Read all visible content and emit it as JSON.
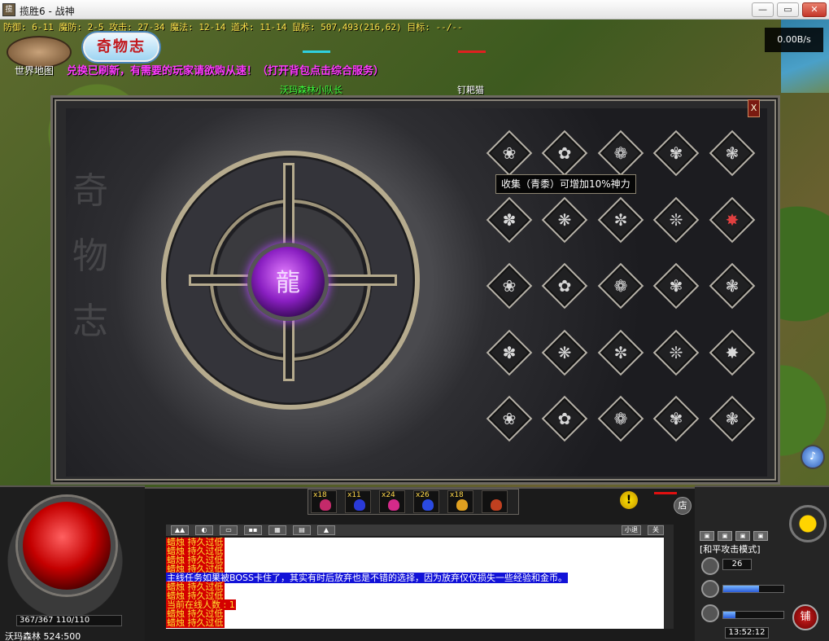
{
  "window": {
    "title": "揽胜6 - 战神",
    "app_icon": "揽"
  },
  "hud_top": {
    "stats_line": "防御: 6-11 魔防: 2-5 攻击: 27-34 魔法: 12-14 道术: 11-14 鼠标: 507,493(216,62) 目标: --/--",
    "net_speed": "0.00B/s",
    "world_map_label": "世界地图",
    "logo_text": "奇物志",
    "broadcast": "兑换已刷新，有需要的玩家请欲购从速！（打开背包点击综合服务）",
    "npc1": "沃玛森林小队长",
    "npc2": "钉耙猫"
  },
  "panel": {
    "side_text": [
      "奇",
      "物",
      "志"
    ],
    "core_emblem": "龍",
    "tooltip": "收集（青黍）可增加10%神力",
    "close_label": "X",
    "slots": [
      [
        "❀",
        "✿",
        "❁",
        "✾",
        "❃"
      ],
      [
        "✽",
        "❋",
        "✼",
        "❊",
        "✸"
      ],
      [
        "❀",
        "✿",
        "❁",
        "✾",
        "❃"
      ],
      [
        "✽",
        "❋",
        "✼",
        "❊",
        "✸"
      ],
      [
        "❀",
        "✿",
        "❁",
        "✾",
        "❃"
      ]
    ]
  },
  "belt": {
    "slots": [
      {
        "qty": "x18",
        "color": "#c42a6a"
      },
      {
        "qty": "x11",
        "color": "#2a3ad8"
      },
      {
        "qty": "x24",
        "color": "#d42a8a"
      },
      {
        "qty": "x26",
        "color": "#2a4ae0"
      },
      {
        "qty": "x18",
        "color": "#e0a020"
      },
      {
        "qty": "",
        "color": "#c04020"
      }
    ],
    "alert": "!",
    "shop": "店"
  },
  "chat": {
    "minimize": "小退",
    "close": "关",
    "lines": [
      {
        "text": "蜡烛 持久过低",
        "style": "red"
      },
      {
        "text": "蜡烛 持久过低",
        "style": "red"
      },
      {
        "text": "蜡烛 持久过低",
        "style": "red"
      },
      {
        "text": "蜡烛 持久过低",
        "style": "red"
      },
      {
        "text": "主线任务如果被BOSS卡住了，其实有时后放弃也是不错的选择，因为放弃仅仅损失一些经验和金币。",
        "style": "blue"
      },
      {
        "text": "蜡烛 持久过低",
        "style": "red"
      },
      {
        "text": "蜡烛 持久过低",
        "style": "red"
      },
      {
        "text": "当前在线人数 : 1",
        "style": "red"
      },
      {
        "text": "蜡烛 持久过低",
        "style": "red"
      },
      {
        "text": "蜡烛 持久过低",
        "style": "red"
      }
    ]
  },
  "hud_left": {
    "hp_mp": "367/367    110/110",
    "location": "沃玛森林 524:500"
  },
  "hud_right": {
    "mode": "[和平攻击模式]",
    "level": "26",
    "clock": "13:52:12",
    "shop_round": "铺",
    "mp_fill": 0.6,
    "exp_fill": 0.2
  }
}
